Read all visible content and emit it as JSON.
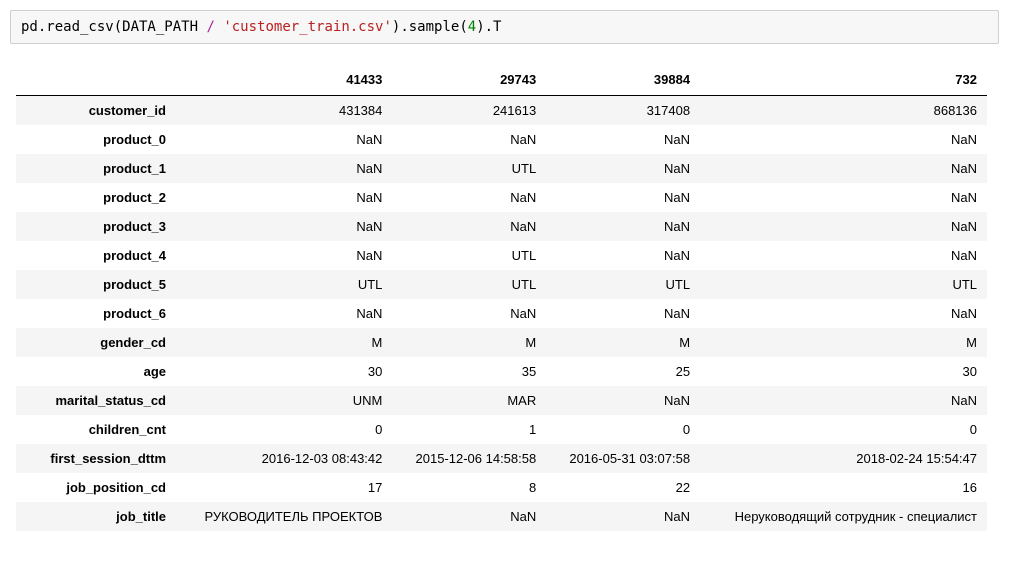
{
  "code": {
    "seg1": "pd.read_csv(DATA_PATH ",
    "op_div": "/",
    "str_lit": "'customer_train.csv'",
    "seg2": ").sample(",
    "num_lit": "4",
    "seg3": ").T"
  },
  "table": {
    "columns": [
      "41433",
      "29743",
      "39884",
      "732"
    ],
    "rows": [
      {
        "name": "customer_id",
        "vals": [
          "431384",
          "241613",
          "317408",
          "868136"
        ]
      },
      {
        "name": "product_0",
        "vals": [
          "NaN",
          "NaN",
          "NaN",
          "NaN"
        ]
      },
      {
        "name": "product_1",
        "vals": [
          "NaN",
          "UTL",
          "NaN",
          "NaN"
        ]
      },
      {
        "name": "product_2",
        "vals": [
          "NaN",
          "NaN",
          "NaN",
          "NaN"
        ]
      },
      {
        "name": "product_3",
        "vals": [
          "NaN",
          "NaN",
          "NaN",
          "NaN"
        ]
      },
      {
        "name": "product_4",
        "vals": [
          "NaN",
          "UTL",
          "NaN",
          "NaN"
        ]
      },
      {
        "name": "product_5",
        "vals": [
          "UTL",
          "UTL",
          "UTL",
          "UTL"
        ]
      },
      {
        "name": "product_6",
        "vals": [
          "NaN",
          "NaN",
          "NaN",
          "NaN"
        ]
      },
      {
        "name": "gender_cd",
        "vals": [
          "M",
          "M",
          "M",
          "M"
        ]
      },
      {
        "name": "age",
        "vals": [
          "30",
          "35",
          "25",
          "30"
        ]
      },
      {
        "name": "marital_status_cd",
        "vals": [
          "UNM",
          "MAR",
          "NaN",
          "NaN"
        ]
      },
      {
        "name": "children_cnt",
        "vals": [
          "0",
          "1",
          "0",
          "0"
        ]
      },
      {
        "name": "first_session_dttm",
        "vals": [
          "2016-12-03 08:43:42",
          "2015-12-06 14:58:58",
          "2016-05-31 03:07:58",
          "2018-02-24 15:54:47"
        ]
      },
      {
        "name": "job_position_cd",
        "vals": [
          "17",
          "8",
          "22",
          "16"
        ]
      },
      {
        "name": "job_title",
        "vals": [
          "РУКОВОДИТЕЛЬ ПРОЕКТОВ",
          "NaN",
          "NaN",
          "Неруководящий сотрудник - специалист"
        ]
      }
    ]
  }
}
